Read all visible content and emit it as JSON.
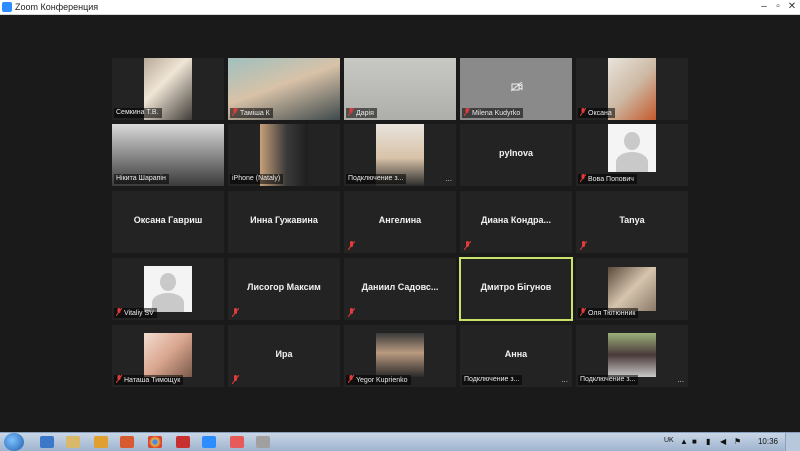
{
  "window": {
    "title": "Zoom Конференция"
  },
  "tiles": [
    {
      "label": "Семкина Т.В."
    },
    {
      "label": "Таміша К"
    },
    {
      "label": "Дарія"
    },
    {
      "label": "Milena Kudyrko"
    },
    {
      "label": "Оксана"
    },
    {
      "label": "Нікита Шарапін"
    },
    {
      "label": "iPhone (Nataly)"
    },
    {
      "label": "Подключение з...",
      "overflow": "..."
    },
    {
      "name": "pyInova"
    },
    {
      "label": "Вова Попович"
    },
    {
      "name": "Оксана Гавриш"
    },
    {
      "name": "Инна Гужавина"
    },
    {
      "name": "Ангелина"
    },
    {
      "name": "Диана Кондра..."
    },
    {
      "name": "Tanya"
    },
    {
      "label": "Vitaliy SV"
    },
    {
      "name": "Лисогор Максим"
    },
    {
      "name": "Даниил Садовс..."
    },
    {
      "name": "Дмитро Бігунов"
    },
    {
      "label": "Оля Тютюнник"
    },
    {
      "label": "Наташа Тимощук"
    },
    {
      "name": "Ира"
    },
    {
      "label": "Yegor Kuprienko"
    },
    {
      "name": "Анна",
      "label": "Подключение з...",
      "overflow": "..."
    },
    {
      "label": "Подключение з...",
      "overflow": "..."
    }
  ],
  "taskbar": {
    "language": "UK",
    "clock": "10:36"
  },
  "colors": {
    "background": "#1a1a1a",
    "tile": "#232323",
    "active_speaker_border": "#c8e26a",
    "muted_mic": "#e23b3b",
    "zoom_blue": "#2d8cff"
  }
}
